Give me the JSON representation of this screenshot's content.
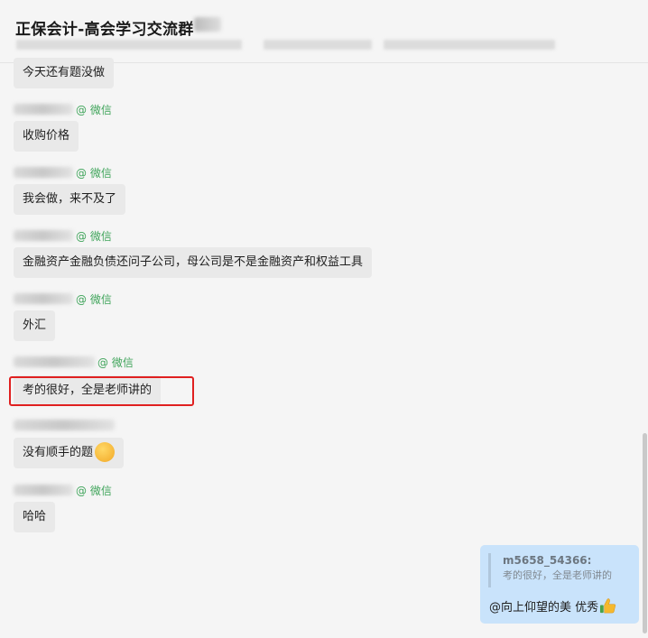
{
  "header": {
    "title": "正保会计-高会学习交流群"
  },
  "messages": [
    {
      "text": "今天还有题没做",
      "sender_tag": ""
    },
    {
      "text": "收购价格",
      "sender_tag": "@ 微信"
    },
    {
      "text": "我会做，来不及了",
      "sender_tag": "@ 微信"
    },
    {
      "text": "金融资产金融负债还问子公司，母公司是不是金融资产和权益工具",
      "sender_tag": "@ 微信"
    },
    {
      "text": "外汇",
      "sender_tag": "@ 微信"
    },
    {
      "text": "考的很好，全是老师讲的",
      "sender_tag": "@ 微信"
    },
    {
      "text": "没有顺手的题",
      "sender_tag": ""
    },
    {
      "text": "哈哈",
      "sender_tag": "@ 微信"
    }
  ],
  "reply": {
    "quote_name": "m5658_54366:",
    "quote_text": "考的很好，全是老师讲的",
    "text": "@向上仰望的美  优秀"
  },
  "icons": {
    "emoji": "laughing-face-emoji",
    "reply_icon": "thumbs-up-icon"
  },
  "colors": {
    "wechat_tag": "#3fa45a",
    "highlight_border": "#e02020",
    "my_bubble": "#c9e3fb",
    "other_bubble": "#e9e9e9"
  }
}
